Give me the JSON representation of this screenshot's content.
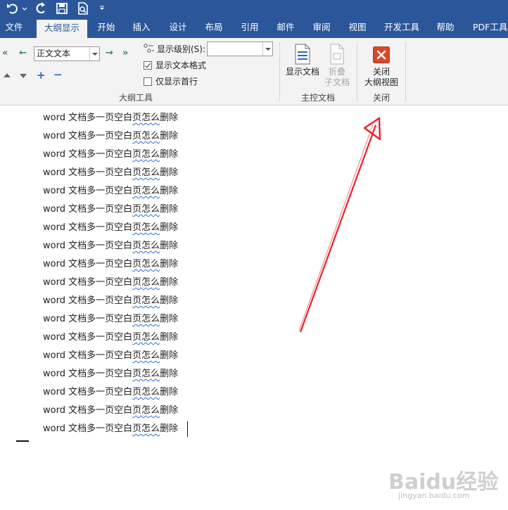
{
  "tabs": [
    "文件",
    "大纲显示",
    "开始",
    "插入",
    "设计",
    "布局",
    "引用",
    "邮件",
    "审阅",
    "视图",
    "开发工具",
    "帮助",
    "PDF工具"
  ],
  "active_tab": "大纲显示",
  "outline_tools": {
    "level_select": "正文文本",
    "show_level_label": "显示级别(S):",
    "show_level_value": "",
    "show_text_format_label": "显示文本格式",
    "show_text_format_checked": true,
    "show_first_line_label": "仅显示首行",
    "show_first_line_checked": false,
    "group_label": "大纲工具"
  },
  "master_doc": {
    "show_document_label": "显示文档",
    "collapse_subdoc_label_1": "折叠",
    "collapse_subdoc_label_2": "子文档",
    "group_label": "主控文档"
  },
  "close_group": {
    "close_label_1": "关闭",
    "close_label_2": "大纲视图",
    "group_label": "关闭"
  },
  "document": {
    "line_prefix": "word 文档多一页空白",
    "line_underlined": "页怎么",
    "line_suffix": "删除",
    "line_count": 18
  },
  "colors": {
    "ribbon_blue": "#2b579a",
    "close_icon_red": "#d9472b",
    "annotation_red": "#e8202a"
  },
  "watermark": {
    "main": "Baidu经验",
    "sub": "jingyan.baidu.com"
  }
}
